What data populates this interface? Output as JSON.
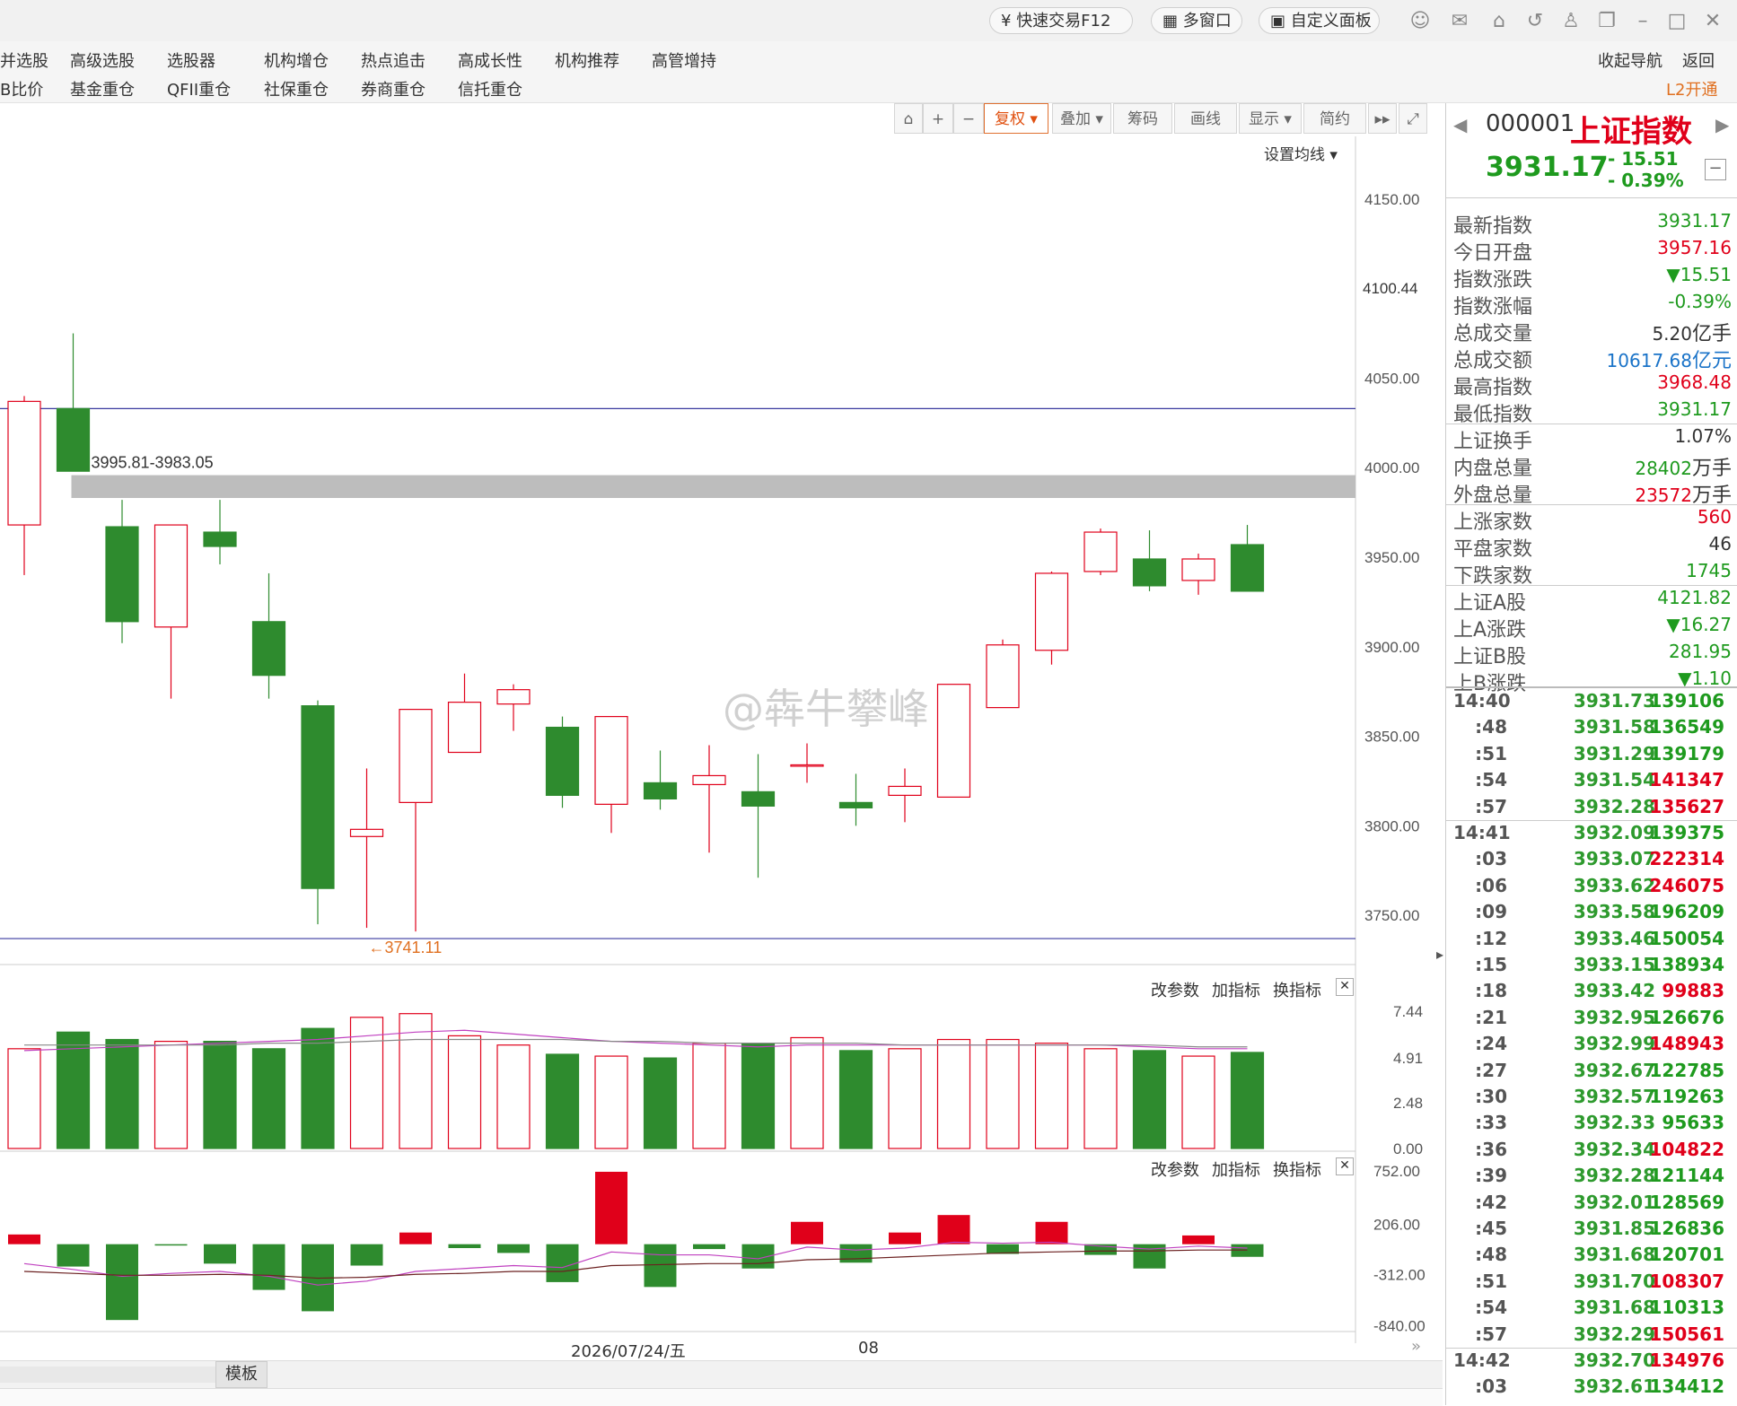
{
  "titlebar": {
    "quick_trade": "快速交易F12",
    "multi_window": "多窗口",
    "custom_panel": "自定义面板"
  },
  "menu": {
    "row1": [
      "并选股",
      "高级选股",
      "选股器",
      "机构增仓",
      "热点追击",
      "高成长性",
      "机构推荐",
      "高管增持"
    ],
    "row2": [
      "B比价",
      "基金重仓",
      "QFII重仓",
      "社保重仓",
      "券商重仓",
      "信托重仓"
    ],
    "collapse_nav": "收起导航",
    "back": "返回",
    "l2": "L2开通"
  },
  "toolbar": {
    "fuquan": "复权",
    "overlay": "叠加",
    "chips": "筹码",
    "draw": "画线",
    "display": "显示",
    "simple": "简约",
    "set_ma": "设置均线"
  },
  "chart_data": [
    {
      "type": "candlestick",
      "name": "main",
      "y_ticks": [
        "4150.00",
        "4100.00",
        "4050.00",
        "4000.00",
        "3950.00",
        "3900.00",
        "3850.00",
        "3800.00",
        "3750.00"
      ],
      "ylim": [
        3725,
        4185
      ],
      "current_price_tag": "4100.44",
      "zone_label": "3995.81-3983.05",
      "zone": [
        3983.05,
        3995.81
      ],
      "hline_top": 4033,
      "hline_bottom": 3737,
      "low_marker": "←3741.11",
      "low_value": 3741.11,
      "candles": [
        {
          "o": 3968,
          "c": 4037,
          "h": 4040,
          "l": 3940
        },
        {
          "o": 4033,
          "c": 3998,
          "h": 4075,
          "l": 3998
        },
        {
          "o": 3967,
          "c": 3914,
          "h": 3982,
          "l": 3902
        },
        {
          "o": 3911,
          "c": 3968,
          "h": 3968,
          "l": 3871
        },
        {
          "o": 3964,
          "c": 3956,
          "h": 3982,
          "l": 3946
        },
        {
          "o": 3914,
          "c": 3884,
          "h": 3941,
          "l": 3871
        },
        {
          "o": 3867,
          "c": 3765,
          "h": 3870,
          "l": 3745
        },
        {
          "o": 3794,
          "c": 3798,
          "h": 3832,
          "l": 3743
        },
        {
          "o": 3813,
          "c": 3865,
          "h": 3865,
          "l": 3741
        },
        {
          "o": 3841,
          "c": 3869,
          "h": 3885,
          "l": 3841
        },
        {
          "o": 3868,
          "c": 3876,
          "h": 3879,
          "l": 3853
        },
        {
          "o": 3855,
          "c": 3817,
          "h": 3861,
          "l": 3810
        },
        {
          "o": 3812,
          "c": 3861,
          "h": 3861,
          "l": 3796
        },
        {
          "o": 3824,
          "c": 3815,
          "h": 3842,
          "l": 3809
        },
        {
          "o": 3823,
          "c": 3828,
          "h": 3845,
          "l": 3785
        },
        {
          "o": 3819,
          "c": 3811,
          "h": 3840,
          "l": 3771
        },
        {
          "o": 3834,
          "c": 3834,
          "h": 3846,
          "l": 3824
        },
        {
          "o": 3813,
          "c": 3810,
          "h": 3829,
          "l": 3800
        },
        {
          "o": 3817,
          "c": 3822,
          "h": 3832,
          "l": 3802
        },
        {
          "o": 3816,
          "c": 3879,
          "h": 3879,
          "l": 3816
        },
        {
          "o": 3866,
          "c": 3901,
          "h": 3904,
          "l": 3866
        },
        {
          "o": 3898,
          "c": 3941,
          "h": 3942,
          "l": 3890
        },
        {
          "o": 3942,
          "c": 3964,
          "h": 3966,
          "l": 3940
        },
        {
          "o": 3949,
          "c": 3934,
          "h": 3965,
          "l": 3931
        },
        {
          "o": 3937,
          "c": 3949,
          "h": 3952,
          "l": 3929
        },
        {
          "o": 3957,
          "c": 3931,
          "h": 3968,
          "l": 3931
        }
      ]
    },
    {
      "type": "bar",
      "name": "volume",
      "y_ticks": [
        "7.44",
        "4.91",
        "2.48",
        "0.00"
      ],
      "ylim": [
        0,
        8.5
      ],
      "values": [
        5.4,
        6.3,
        5.9,
        5.8,
        5.8,
        5.4,
        6.5,
        7.1,
        7.3,
        6.1,
        5.6,
        5.1,
        5.0,
        4.9,
        5.7,
        5.7,
        6.0,
        5.3,
        5.4,
        5.9,
        5.9,
        5.7,
        5.4,
        5.3,
        5.0,
        5.2
      ],
      "up": [
        true,
        false,
        false,
        true,
        false,
        false,
        false,
        true,
        true,
        true,
        true,
        false,
        true,
        false,
        true,
        false,
        true,
        false,
        true,
        true,
        true,
        true,
        true,
        false,
        true,
        false
      ],
      "ma1": [
        5.3,
        5.4,
        5.5,
        5.6,
        5.7,
        5.8,
        5.9,
        6.1,
        6.3,
        6.4,
        6.2,
        6.0,
        5.8,
        5.7,
        5.6,
        5.5,
        5.6,
        5.6,
        5.6,
        5.6,
        5.6,
        5.6,
        5.6,
        5.5,
        5.4,
        5.4
      ],
      "ma2": [
        5.6,
        5.6,
        5.6,
        5.6,
        5.6,
        5.7,
        5.7,
        5.8,
        5.9,
        5.9,
        5.9,
        5.9,
        5.8,
        5.8,
        5.7,
        5.7,
        5.7,
        5.7,
        5.6,
        5.6,
        5.6,
        5.6,
        5.6,
        5.6,
        5.5,
        5.5
      ]
    },
    {
      "type": "bar",
      "name": "indicator",
      "y_ticks": [
        "752.00",
        "206.00",
        "-312.00",
        "-840.00"
      ],
      "ylim": [
        -880,
        800
      ],
      "values": [
        100,
        -230,
        -780,
        -10,
        -200,
        -470,
        -690,
        -220,
        120,
        -40,
        -90,
        -390,
        745,
        -440,
        -50,
        -250,
        230,
        -190,
        120,
        300,
        -100,
        230,
        -110,
        -250,
        90,
        -130
      ],
      "line1": [
        -200,
        -260,
        -330,
        -300,
        -280,
        -330,
        -420,
        -380,
        -280,
        -250,
        -220,
        -240,
        -80,
        -110,
        -110,
        -150,
        -30,
        -60,
        -40,
        20,
        10,
        20,
        -20,
        -50,
        -20,
        -40
      ],
      "line2": [
        -280,
        -300,
        -320,
        -320,
        -310,
        -320,
        -350,
        -340,
        -310,
        -300,
        -280,
        -280,
        -220,
        -210,
        -200,
        -200,
        -160,
        -150,
        -130,
        -110,
        -90,
        -80,
        -70,
        -70,
        -60,
        -60
      ]
    }
  ],
  "x_axis": {
    "date_label": "2026/07/24/五",
    "month_label": "08"
  },
  "indicator_panel": {
    "change_params": "改参数",
    "add_indicator": "加指标",
    "switch_indicator": "换指标"
  },
  "bottom": {
    "template": "模板"
  },
  "watermark": "@犇牛攀峰",
  "quote": {
    "code": "000001",
    "name": "上证指数",
    "price": "3931.17",
    "change": "- 15.51",
    "change_pct": "- 0.39%"
  },
  "stats": [
    {
      "label": "最新指数",
      "value": "3931.17",
      "color": "green",
      "unit": ""
    },
    {
      "label": "今日开盘",
      "value": "3957.16",
      "color": "red",
      "unit": ""
    },
    {
      "label": "指数涨跌",
      "value": "▼15.51",
      "color": "green",
      "unit": ""
    },
    {
      "label": "指数涨幅",
      "value": "-0.39%",
      "color": "green",
      "unit": ""
    },
    {
      "label": "总成交量",
      "value": "5.20",
      "color": "dark",
      "unit": "亿手"
    },
    {
      "label": "总成交额",
      "value": "10617.68",
      "color": "blue",
      "unit": "亿元"
    },
    {
      "label": "最高指数",
      "value": "3968.48",
      "color": "red",
      "unit": ""
    },
    {
      "label": "最低指数",
      "value": "3931.17",
      "color": "green",
      "unit": ""
    },
    {
      "label": "上证换手",
      "value": "1.07%",
      "color": "dark",
      "unit": ""
    },
    {
      "label": "内盘总量",
      "value": "28402",
      "color": "green",
      "unit": "万手"
    },
    {
      "label": "外盘总量",
      "value": "23572",
      "color": "red",
      "unit": "万手"
    },
    {
      "label": "上涨家数",
      "value": "560",
      "color": "red",
      "unit": ""
    },
    {
      "label": "平盘家数",
      "value": "46",
      "color": "dark",
      "unit": ""
    },
    {
      "label": "下跌家数",
      "value": "1745",
      "color": "green",
      "unit": ""
    },
    {
      "label": "上证A股",
      "value": "4121.82",
      "color": "green",
      "unit": ""
    },
    {
      "label": "上A涨跌",
      "value": "▼16.27",
      "color": "green",
      "unit": ""
    },
    {
      "label": "上证B股",
      "value": "281.95",
      "color": "green",
      "unit": ""
    },
    {
      "label": "上B涨跌",
      "value": "▼1.10",
      "color": "green",
      "unit": ""
    }
  ],
  "ticks": [
    {
      "time": "14:40",
      "price": "3931.73",
      "vol": "139106",
      "vc": "green"
    },
    {
      "time": ":48",
      "price": "3931.58",
      "vol": "136549",
      "vc": "green"
    },
    {
      "time": ":51",
      "price": "3931.29",
      "vol": "139179",
      "vc": "green"
    },
    {
      "time": ":54",
      "price": "3931.54",
      "vol": "141347",
      "vc": "red"
    },
    {
      "time": ":57",
      "price": "3932.28",
      "vol": "135627",
      "vc": "red"
    },
    {
      "time": "14:41",
      "price": "3932.09",
      "vol": "139375",
      "vc": "green"
    },
    {
      "time": ":03",
      "price": "3933.07",
      "vol": "222314",
      "vc": "red"
    },
    {
      "time": ":06",
      "price": "3933.62",
      "vol": "246075",
      "vc": "red"
    },
    {
      "time": ":09",
      "price": "3933.58",
      "vol": "196209",
      "vc": "green"
    },
    {
      "time": ":12",
      "price": "3933.46",
      "vol": "150054",
      "vc": "green"
    },
    {
      "time": ":15",
      "price": "3933.15",
      "vol": "138934",
      "vc": "green"
    },
    {
      "time": ":18",
      "price": "3933.42",
      "vol": "99883",
      "vc": "red"
    },
    {
      "time": ":21",
      "price": "3932.95",
      "vol": "126676",
      "vc": "green"
    },
    {
      "time": ":24",
      "price": "3932.99",
      "vol": "148943",
      "vc": "red"
    },
    {
      "time": ":27",
      "price": "3932.67",
      "vol": "122785",
      "vc": "green"
    },
    {
      "time": ":30",
      "price": "3932.57",
      "vol": "119263",
      "vc": "green"
    },
    {
      "time": ":33",
      "price": "3932.33",
      "vol": "95633",
      "vc": "green"
    },
    {
      "time": ":36",
      "price": "3932.34",
      "vol": "104822",
      "vc": "red"
    },
    {
      "time": ":39",
      "price": "3932.28",
      "vol": "121144",
      "vc": "green"
    },
    {
      "time": ":42",
      "price": "3932.01",
      "vol": "128569",
      "vc": "green"
    },
    {
      "time": ":45",
      "price": "3931.85",
      "vol": "126836",
      "vc": "green"
    },
    {
      "time": ":48",
      "price": "3931.68",
      "vol": "120701",
      "vc": "green"
    },
    {
      "time": ":51",
      "price": "3931.70",
      "vol": "108307",
      "vc": "red"
    },
    {
      "time": ":54",
      "price": "3931.68",
      "vol": "110313",
      "vc": "green"
    },
    {
      "time": ":57",
      "price": "3932.29",
      "vol": "150561",
      "vc": "red"
    },
    {
      "time": "14:42",
      "price": "3932.70",
      "vol": "134976",
      "vc": "red"
    },
    {
      "time": ":03",
      "price": "3932.61",
      "vol": "134412",
      "vc": "green"
    }
  ],
  "colors": {
    "up": "#e0001a",
    "down": "#2e8b2e",
    "hline": "#3a3aa0",
    "zone": "#bdbdbd",
    "ma_purple": "#c040c0",
    "ma_gray": "#888888"
  }
}
